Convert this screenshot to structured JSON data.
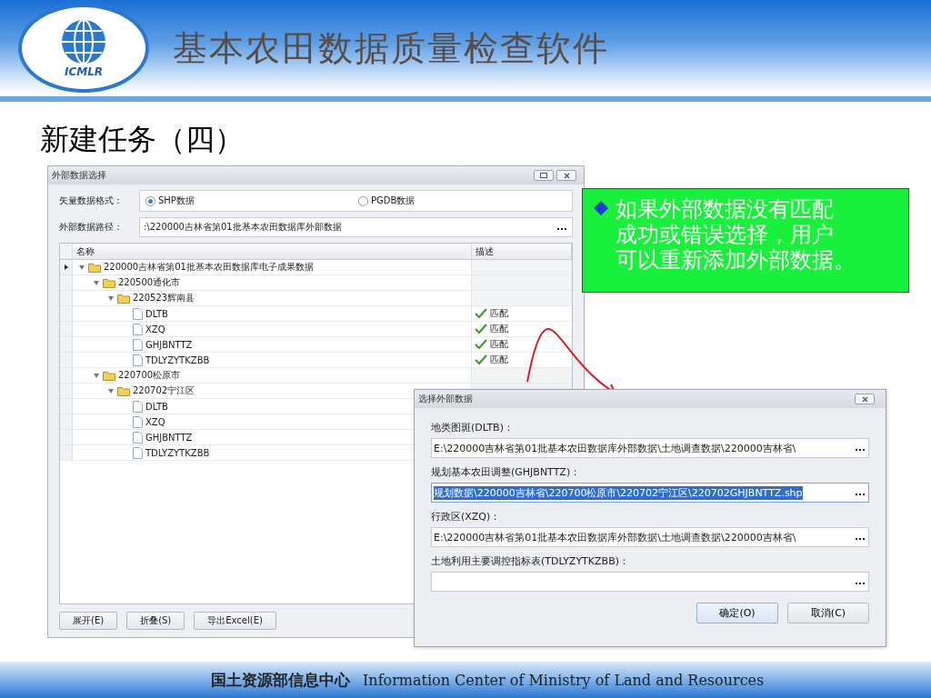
{
  "header": {
    "logo_text": "ICMLR",
    "title": "基本农田数据质量检查软件"
  },
  "subtitle": "新建任务（四）",
  "main_window": {
    "title": "外部数据选择",
    "format_label": "矢量数据格式：",
    "formats": [
      {
        "label": "SHP数据",
        "selected": true
      },
      {
        "label": "PGDB数据",
        "selected": false
      }
    ],
    "path_label": "外部数据路径：",
    "path_value": ":\\220000吉林省第01批基本农田数据库外部数据",
    "columns": [
      "名称",
      "描述"
    ],
    "tree": [
      {
        "label": "220000吉林省第01批基本农田数据库电子成果数据",
        "kind": "root",
        "expanded": true,
        "children": [
          {
            "label": "220500通化市",
            "kind": "folder",
            "expanded": true,
            "children": [
              {
                "label": "220523辉南县",
                "kind": "folder",
                "expanded": true,
                "children": [
                  {
                    "label": "DLTB",
                    "kind": "file",
                    "description": "匹配"
                  },
                  {
                    "label": "XZQ",
                    "kind": "file",
                    "description": "匹配"
                  },
                  {
                    "label": "GHJBNTTZ",
                    "kind": "file",
                    "description": "匹配"
                  },
                  {
                    "label": "TDLYZYTKZBB",
                    "kind": "file",
                    "description": "匹配"
                  }
                ]
              }
            ]
          },
          {
            "label": "220700松原市",
            "kind": "folder",
            "expanded": true,
            "children": [
              {
                "label": "220702宁江区",
                "kind": "folder",
                "expanded": true,
                "children": [
                  {
                    "label": "DLTB",
                    "kind": "file"
                  },
                  {
                    "label": "XZQ",
                    "kind": "file"
                  },
                  {
                    "label": "GHJBNTTZ",
                    "kind": "file"
                  },
                  {
                    "label": "TDLYZYTKZBB",
                    "kind": "file"
                  }
                ]
              }
            ]
          }
        ]
      }
    ],
    "buttons": [
      "展开(E)",
      "折叠(S)",
      "导出Excel(E)"
    ]
  },
  "callout": {
    "lines": [
      "如果外部数据没有匹配",
      "成功或错误选择，用户",
      "可以重新添加外部数据。"
    ]
  },
  "dialog": {
    "title": "选择外部数据",
    "fields": [
      {
        "label": "地类图斑(DLTB)：",
        "value": "E:\\220000吉林省第01批基本农田数据库外部数据\\土地调查数据\\220000吉林省\\",
        "selected": false
      },
      {
        "label": "规划基本农田调整(GHJBNTTZ)：",
        "value": "规划数据\\220000吉林省\\220700松原市\\220702宁江区\\220702GHJBNTTZ.shp",
        "selected": true
      },
      {
        "label": "行政区(XZQ)：",
        "value": "E:\\220000吉林省第01批基本农田数据库外部数据\\土地调查数据\\220000吉林省\\",
        "selected": false
      },
      {
        "label": "土地利用主要调控指标表(TDLYZYTKZBB)：",
        "selected": false
      }
    ],
    "buttons": [
      {
        "label": "确定(O)",
        "focused": true
      },
      {
        "label": "取消(C)",
        "focused": false
      }
    ]
  },
  "footer": {
    "chinese": "国土资源部信息中心",
    "english": "Information Center of Ministry of Land and Resources"
  }
}
